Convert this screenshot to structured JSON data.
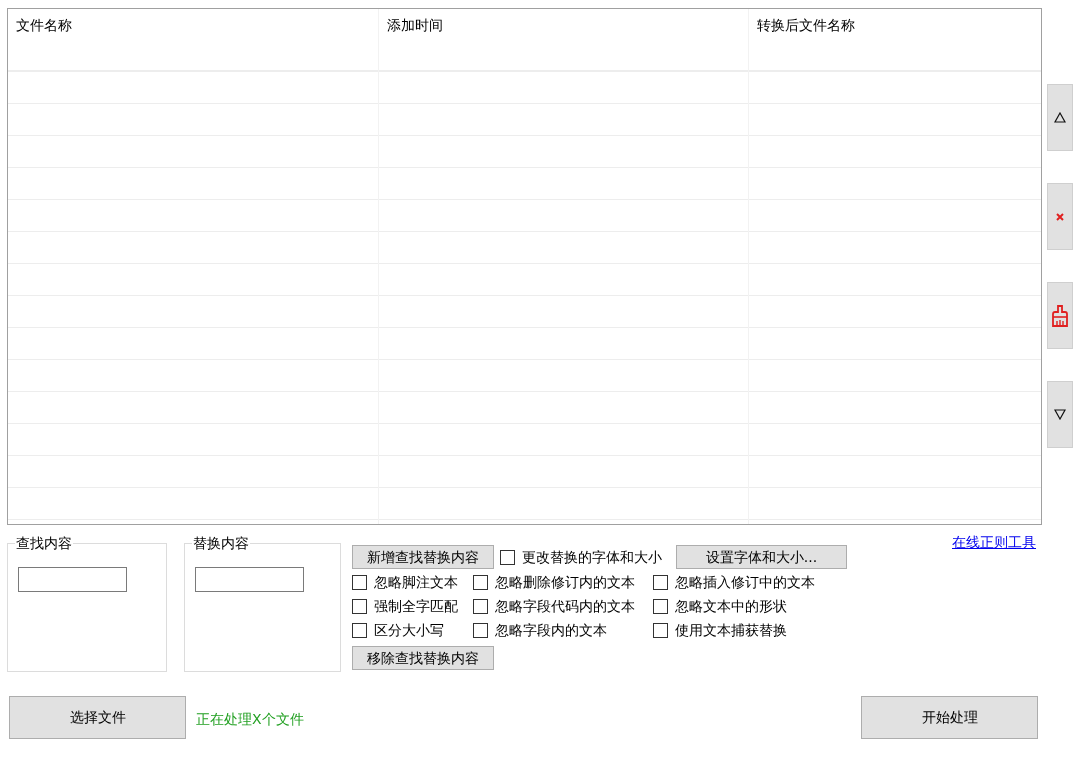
{
  "table": {
    "columns": [
      "文件名称",
      "添加时间",
      "转换后文件名称"
    ]
  },
  "side_buttons": [
    {
      "kind": "up"
    },
    {
      "kind": "delete"
    },
    {
      "kind": "clear"
    },
    {
      "kind": "down"
    }
  ],
  "find_group": {
    "title": "查找内容"
  },
  "replace_group": {
    "title": "替换内容"
  },
  "add_button": "新增查找替换内容",
  "font_option": {
    "label": "更改替换的字体和大小",
    "checked": false
  },
  "font_button": "设置字体和大小...",
  "options": [
    {
      "label": "忽略脚注文本",
      "checked": false
    },
    {
      "label": "忽略删除修订内的文本",
      "checked": false
    },
    {
      "label": "忽略插入修订中的文本",
      "checked": false
    },
    {
      "label": "强制全字匹配",
      "checked": false
    },
    {
      "label": "忽略字段代码内的文本",
      "checked": false
    },
    {
      "label": "忽略文本中的形状",
      "checked": false
    },
    {
      "label": "区分大小写",
      "checked": false
    },
    {
      "label": "忽略字段内的文本",
      "checked": false
    },
    {
      "label": "使用文本捕获替换",
      "checked": false
    }
  ],
  "remove_button": "移除查找替换内容",
  "regex_link": "在线正则工具",
  "select_button": "选择文件",
  "status": "正在处理X个文件",
  "start_button": "开始处理"
}
